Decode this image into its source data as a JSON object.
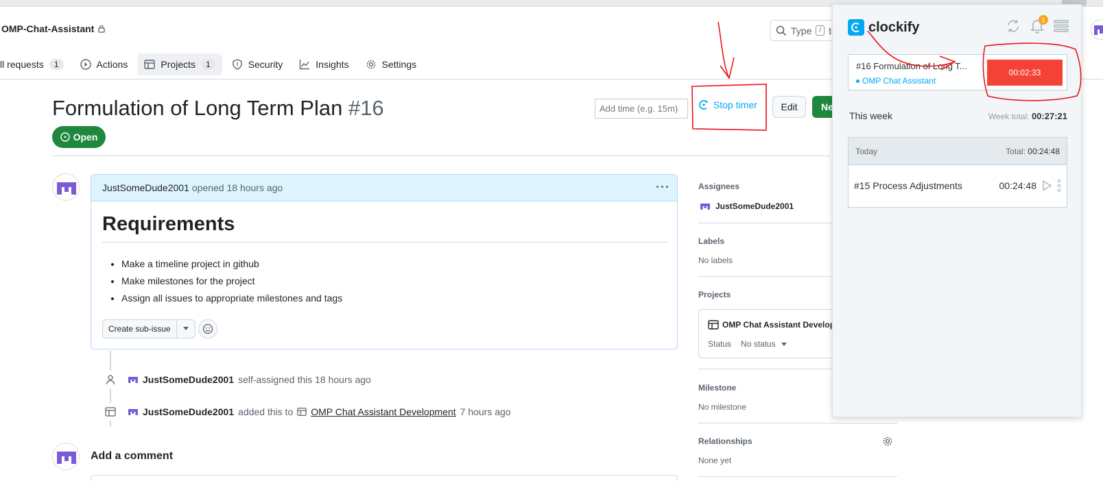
{
  "repo": {
    "name": "OMP-Chat-Assistant"
  },
  "search": {
    "label": "Type",
    "key": "/",
    "tail": "to"
  },
  "nav": {
    "items": [
      {
        "label": "ll requests",
        "count": "1"
      },
      {
        "label": "Actions"
      },
      {
        "label": "Projects",
        "count": "1"
      },
      {
        "label": "Security"
      },
      {
        "label": "Insights"
      },
      {
        "label": "Settings"
      }
    ]
  },
  "issue": {
    "title": "Formulation of Long Term Plan",
    "number": "#16",
    "state": "Open",
    "add_time_placeholder": "Add time (e.g. 15m)",
    "stop_timer": "Stop timer",
    "edit": "Edit",
    "new": "New"
  },
  "comment": {
    "author": "JustSomeDude2001",
    "meta": "opened 18 hours ago",
    "heading": "Requirements",
    "bullets": [
      "Make a timeline project in github",
      "Make milestones for the project",
      "Assign all issues to appropriate milestones and tags"
    ],
    "create_sub_issue": "Create sub-issue"
  },
  "timeline": [
    {
      "user": "JustSomeDude2001",
      "text": "self-assigned this 18 hours ago"
    },
    {
      "user": "JustSomeDude2001",
      "pre": "added this to",
      "link": "OMP Chat Assistant Development",
      "post": "7 hours ago"
    }
  ],
  "add_comment": "Add a comment",
  "sidebar": {
    "assignees_label": "Assignees",
    "assignee": "JustSomeDude2001",
    "labels_label": "Labels",
    "labels_value": "No labels",
    "projects_label": "Projects",
    "project_name": "OMP Chat Assistant Developm",
    "status_label": "Status",
    "status_value": "No status",
    "milestone_label": "Milestone",
    "milestone_value": "No milestone",
    "relationships_label": "Relationships",
    "relationships_value": "None yet"
  },
  "clockify": {
    "brand": "clockify",
    "notification_count": "1",
    "current_entry": "#16 Formulation of Long T...",
    "current_project": "OMP Chat Assistant",
    "timer": "00:02:33",
    "this_week": "This week",
    "week_total_label": "Week total:",
    "week_total": "00:27:21",
    "today_label": "Today",
    "today_total_label": "Total:",
    "today_total": "00:24:48",
    "entries": [
      {
        "name": "#15 Process Adjustments",
        "duration": "00:24:48"
      }
    ]
  },
  "colors": {
    "accent": "#03a9f4",
    "open_green": "#1f883d",
    "stop_red": "#f44336",
    "annotation_red": "#e8141c"
  }
}
